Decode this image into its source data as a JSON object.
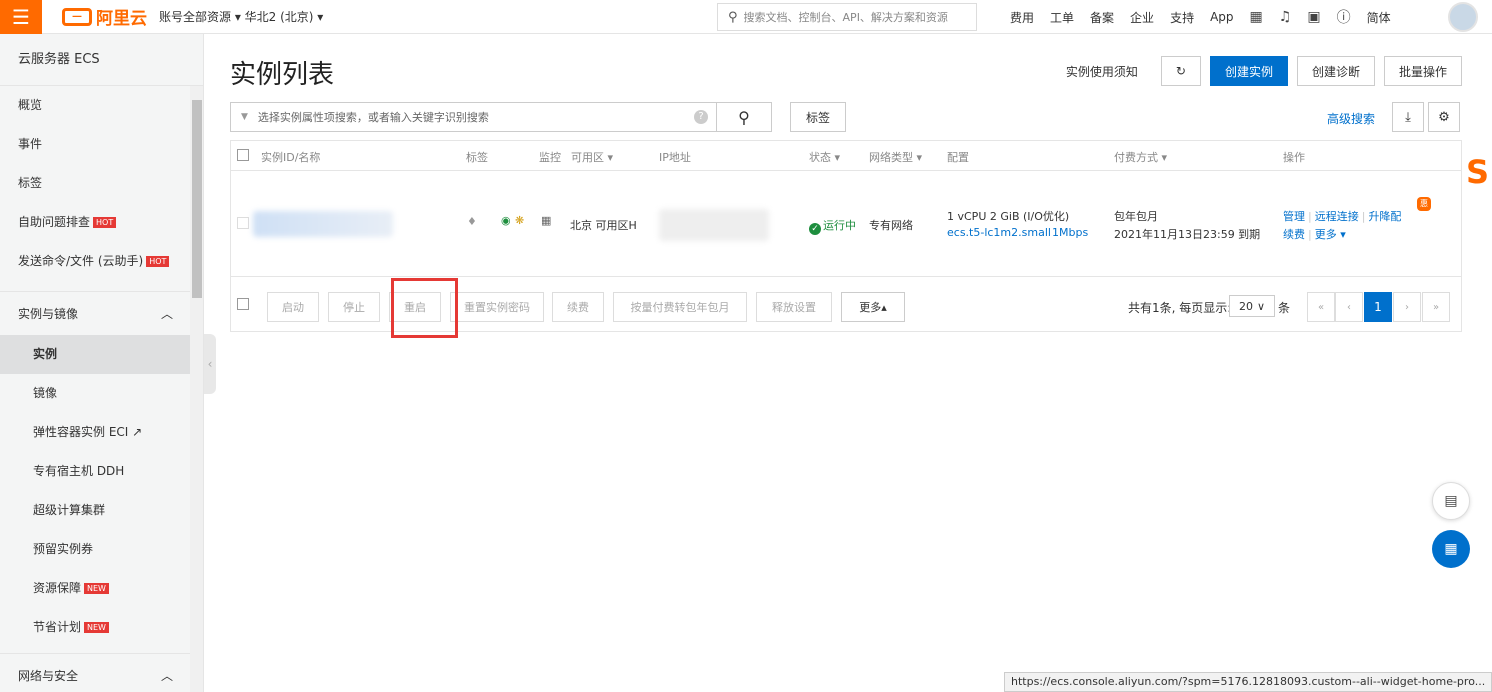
{
  "topbar": {
    "menu_icon": "hamburger-icon",
    "logo_text": "阿里云",
    "region": "账号全部资源 ▾ 华北2 (北京) ▾",
    "search_placeholder": "搜索文档、控制台、API、解决方案和资源",
    "nav": [
      "费用",
      "工单",
      "备案",
      "企业",
      "支持",
      "App"
    ],
    "lang": "简体"
  },
  "sidebar": {
    "title": "云服务器 ECS",
    "items": [
      {
        "label": "概览"
      },
      {
        "label": "事件"
      },
      {
        "label": "标签"
      },
      {
        "label": "自助问题排查",
        "badge": "HOT"
      },
      {
        "label": "发送命令/文件 (云助手)",
        "badge": "HOT"
      }
    ],
    "group1": "实例与镜像",
    "sub_items": [
      {
        "label": "实例",
        "active": true
      },
      {
        "label": "镜像"
      },
      {
        "label": "弹性容器实例 ECI ↗"
      },
      {
        "label": "专有宿主机 DDH"
      },
      {
        "label": "超级计算集群"
      },
      {
        "label": "预留实例券"
      },
      {
        "label": "资源保障",
        "badge": "NEW"
      },
      {
        "label": "节省计划",
        "badge": "NEW"
      }
    ],
    "group2": "网络与安全"
  },
  "main": {
    "title": "实例列表",
    "notice_link": "实例使用须知",
    "create_button": "创建实例",
    "diagnose_button": "创建诊断",
    "batch_button": "批量操作",
    "search_placeholder": "选择实例属性项搜索，或者输入关键字识别搜索",
    "tag_button": "标签",
    "advanced_search": "高级搜索"
  },
  "table": {
    "headers": [
      "实例ID/名称",
      "标签",
      "监控",
      "可用区 ▾",
      "IP地址",
      "状态 ▾",
      "网络类型 ▾",
      "配置",
      "付费方式 ▾",
      "操作"
    ],
    "row": {
      "zone": "北京 可用区H",
      "status": "运行中",
      "network": "专有网络",
      "config_line1": "1 vCPU 2 GiB (I/O优化)",
      "config_type": "ecs.t5-lc1m2.small",
      "bandwidth": "1Mbps",
      "pay_type": "包年包月",
      "expire": "2021年11月13日23:59 到期",
      "ops": [
        "管理",
        "远程连接",
        "升降配",
        "续费",
        "更多 ▾"
      ],
      "upgrade_badge": "惠"
    },
    "footer_buttons": [
      "启动",
      "停止",
      "重启",
      "重置实例密码",
      "续费",
      "按量付费转包年包月",
      "释放设置",
      "更多▴"
    ],
    "pager_text": "共有1条, 每页显示:",
    "page_size": "20",
    "page_size_suffix": "条",
    "current_page": "1"
  },
  "status_url": "https://ecs.console.aliyun.com/?spm=5176.12818093.custom--ali--widget-home-pro..."
}
